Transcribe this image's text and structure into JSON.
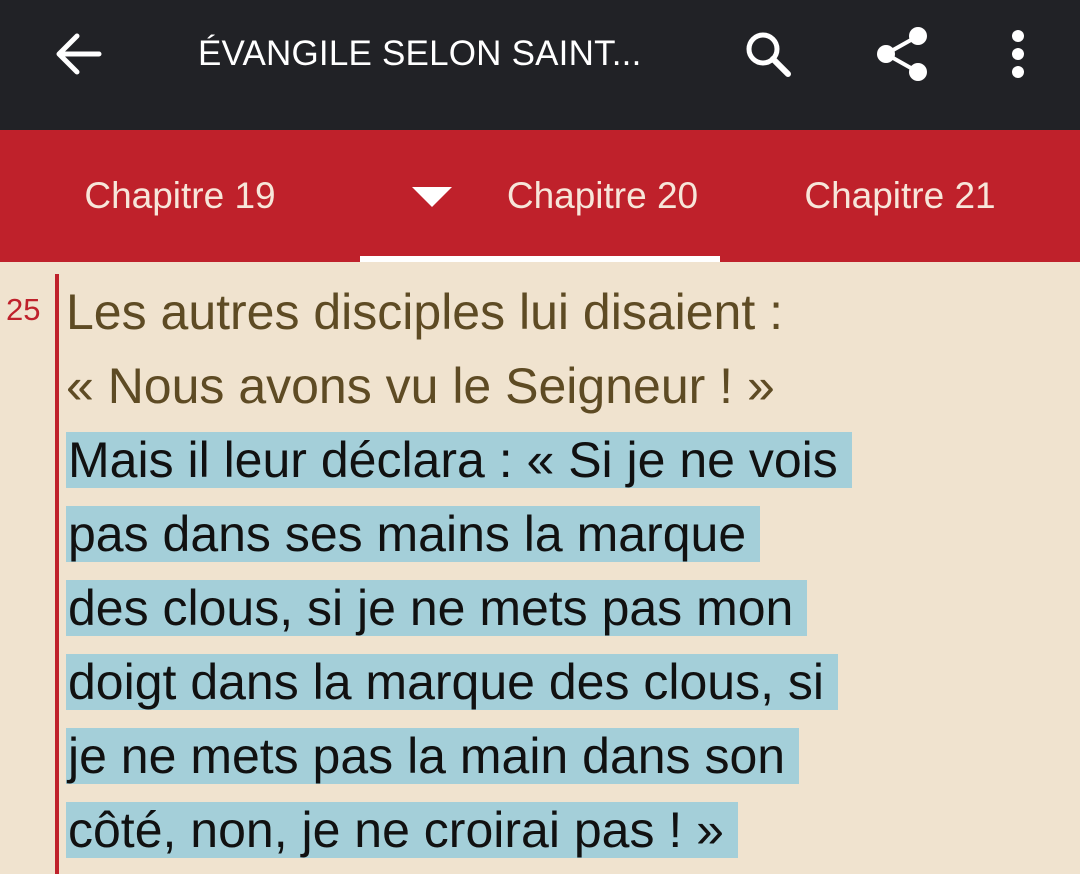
{
  "appbar": {
    "title": "ÉVANGILE SELON SAINT...",
    "icons": [
      "arrow-back-icon",
      "search-icon",
      "share-icon",
      "more-vert-icon"
    ]
  },
  "tabs": [
    {
      "label": "Chapitre 19"
    },
    {
      "label": "Chapitre 20"
    },
    {
      "label": "Chapitre 21"
    }
  ],
  "selected_tab": "Chapitre 20",
  "verse": {
    "number": "25",
    "lines": [
      "Les autres disciples lui disaient :",
      "« Nous avons vu le Seigneur ! »",
      "Mais il leur déclara : « Si je ne vois",
      "pas dans ses mains la marque",
      "des clous, si je ne mets pas mon",
      "doigt dans la marque des clous, si",
      "je ne mets pas la main dans son",
      "côté, non, je ne croirai pas ! »"
    ],
    "highlighted_from_line": 3
  },
  "colors": {
    "appbar": "#212226",
    "tabbar": "#bf212b",
    "page_background": "#f0e3cf",
    "highlight": "#a4cfd9",
    "verse_text": "#5e4b24",
    "verse_marker": "#bf212b"
  }
}
